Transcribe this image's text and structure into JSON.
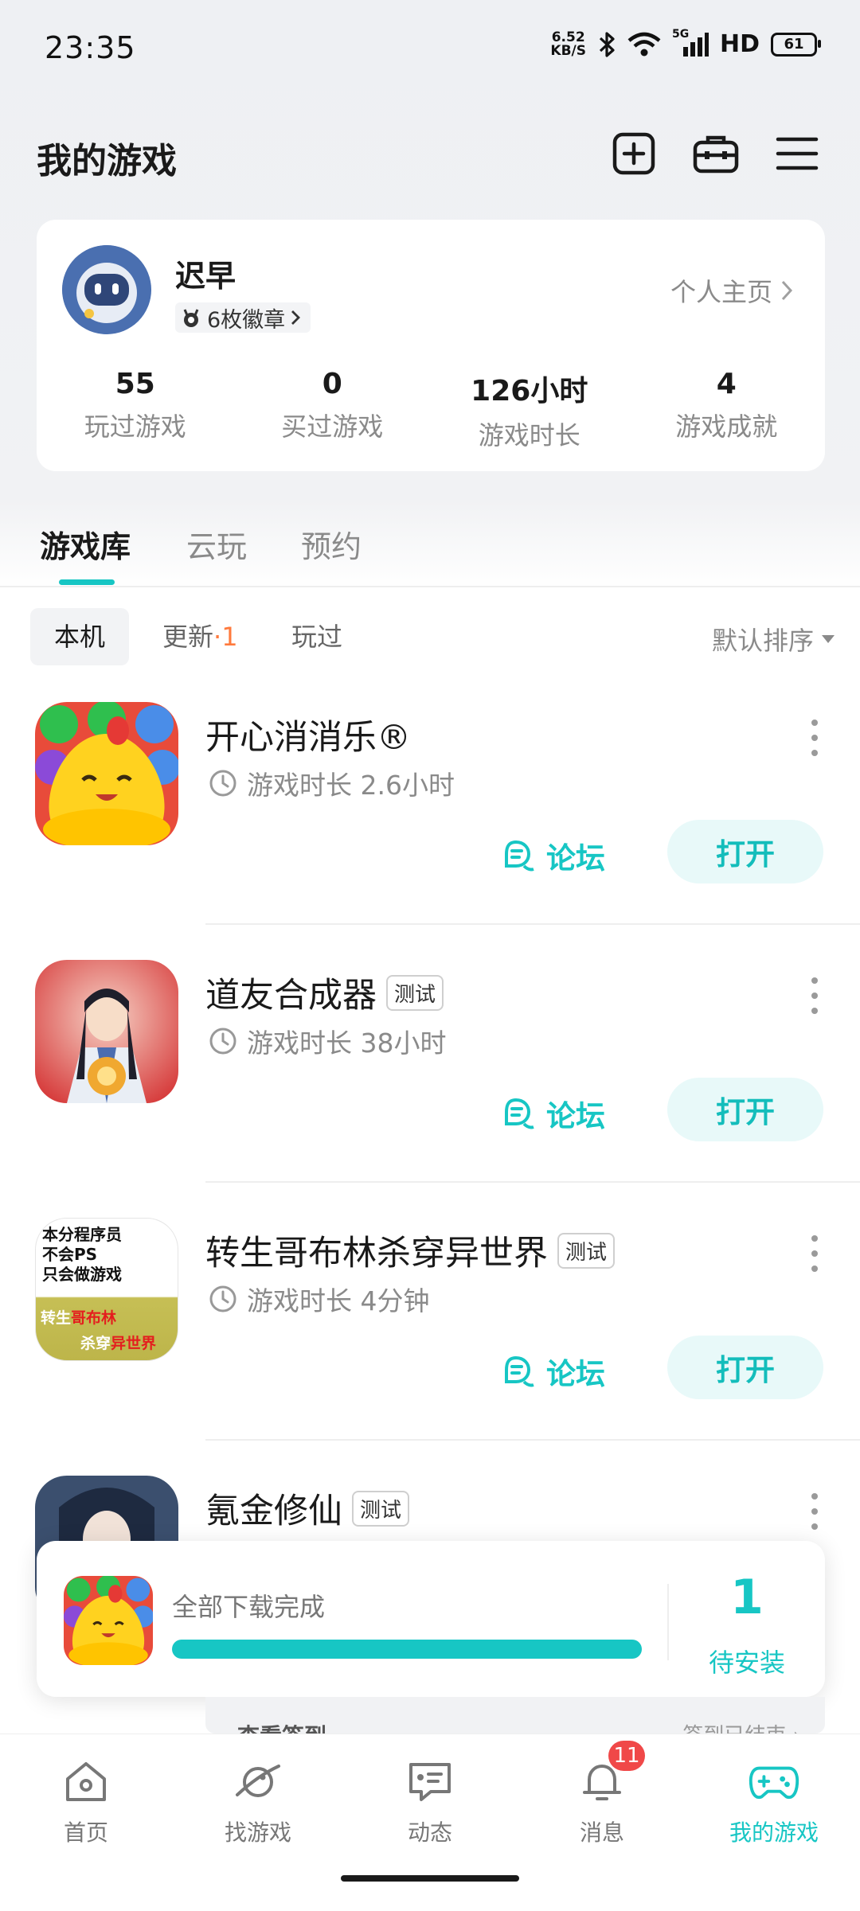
{
  "status_bar": {
    "time": "23:35",
    "net_speed_value": "6.52",
    "net_speed_unit": "KB/S",
    "network": "5G",
    "hd": "HD",
    "battery": "61"
  },
  "header": {
    "title": "我的游戏",
    "icons": [
      "add-icon",
      "toolbox-icon",
      "menu-icon"
    ]
  },
  "profile": {
    "username": "迟早",
    "badges": "6枚徽章",
    "homepage_link": "个人主页",
    "stats": [
      {
        "value": "55",
        "label": "玩过游戏"
      },
      {
        "value": "0",
        "label": "买过游戏"
      },
      {
        "value": "126小时",
        "label": "游戏时长"
      },
      {
        "value": "4",
        "label": "游戏成就"
      }
    ]
  },
  "main_tabs": [
    {
      "label": "游戏库",
      "active": true
    },
    {
      "label": "云玩",
      "active": false
    },
    {
      "label": "预约",
      "active": false
    }
  ],
  "sub_tabs": {
    "local": "本机",
    "update": "更新",
    "update_sep": "·",
    "update_count": "1",
    "played": "玩过",
    "sort": "默认排序"
  },
  "games": [
    {
      "name": "开心消消乐®",
      "tag": "",
      "playtime": "游戏时长 2.6小时",
      "forum": "论坛",
      "open": "打开"
    },
    {
      "name": "道友合成器",
      "tag": "测试",
      "playtime": "游戏时长 38小时",
      "forum": "论坛",
      "open": "打开"
    },
    {
      "name": "转生哥布林杀穿异世界",
      "tag": "测试",
      "playtime": "游戏时长 4分钟",
      "forum": "论坛",
      "open": "打开",
      "icon_text": {
        "line1": "本分程序员",
        "line2": "不会PS",
        "line3": "只会做游戏",
        "t1": "转生",
        "t2": "哥布林",
        "t3": "杀穿",
        "t4": "异世界"
      }
    },
    {
      "name": "氪金修仙",
      "tag": "测试"
    }
  ],
  "peek": {
    "left": "查看签到",
    "right": "签到已结束 ›"
  },
  "download": {
    "status": "全部下载完成",
    "progress": 1.0,
    "pending_count": "1",
    "pending_label": "待安装"
  },
  "bottom_nav": [
    {
      "label": "首页",
      "icon": "home-icon"
    },
    {
      "label": "找游戏",
      "icon": "planet-icon"
    },
    {
      "label": "动态",
      "icon": "chat-icon"
    },
    {
      "label": "消息",
      "icon": "bell-icon",
      "badge": "11"
    },
    {
      "label": "我的游戏",
      "icon": "gamepad-icon",
      "active": true
    }
  ],
  "colors": {
    "accent": "#17c6c4",
    "update_count": "#ff7a3d",
    "badge": "#f04848"
  }
}
